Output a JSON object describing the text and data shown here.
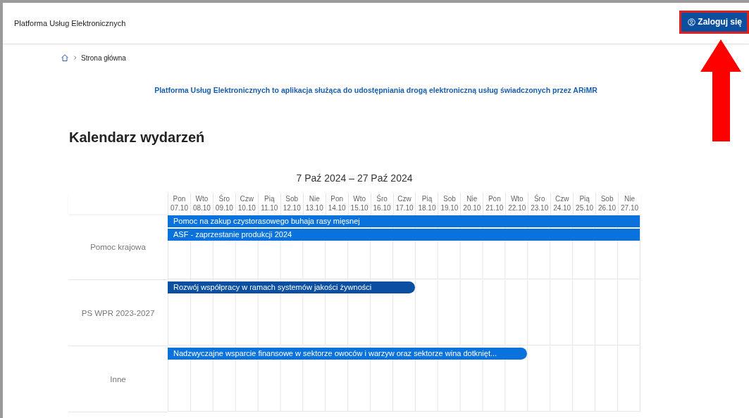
{
  "header": {
    "title": "Platforma Usług Elektronicznych",
    "login_button": "Zaloguj się"
  },
  "breadcrumb": [
    "Strona główna"
  ],
  "tagline": "Platforma Usług Elektronicznych to aplikacja służąca do udostępniania drogą elektroniczną usług świadczonych przez ARiMR",
  "heading": "Kalendarz wydarzeń",
  "calendar": {
    "range": "7 Paź 2024 – 27 Paź 2024",
    "days": [
      {
        "weekday": "Pon",
        "date": "07.10"
      },
      {
        "weekday": "Wto",
        "date": "08.10"
      },
      {
        "weekday": "Śro",
        "date": "09.10"
      },
      {
        "weekday": "Czw",
        "date": "10.10"
      },
      {
        "weekday": "Pią",
        "date": "11.10"
      },
      {
        "weekday": "Sob",
        "date": "12.10"
      },
      {
        "weekday": "Nie",
        "date": "13.10"
      },
      {
        "weekday": "Pon",
        "date": "14.10"
      },
      {
        "weekday": "Wto",
        "date": "15.10"
      },
      {
        "weekday": "Śro",
        "date": "16.10"
      },
      {
        "weekday": "Czw",
        "date": "17.10"
      },
      {
        "weekday": "Pią",
        "date": "18.10"
      },
      {
        "weekday": "Sob",
        "date": "19.10"
      },
      {
        "weekday": "Nie",
        "date": "20.10"
      },
      {
        "weekday": "Pon",
        "date": "21.10"
      },
      {
        "weekday": "Wto",
        "date": "22.10"
      },
      {
        "weekday": "Śro",
        "date": "23.10"
      },
      {
        "weekday": "Czw",
        "date": "24.10"
      },
      {
        "weekday": "Pią",
        "date": "25.10"
      },
      {
        "weekday": "Sob",
        "date": "26.10"
      },
      {
        "weekday": "Nie",
        "date": "27.10"
      }
    ],
    "groups": [
      {
        "name": "Pomoc krajowa",
        "events": [
          {
            "title": "Pomoc na zakup czystorasowego buhaja rasy mięsnej",
            "continues": true,
            "color": "#0a72dd"
          },
          {
            "title": "ASF - zaprzestanie produkcji 2024",
            "continues": true,
            "color": "#0a72dd"
          }
        ]
      },
      {
        "name": "PS WPR 2023-2027",
        "events": [
          {
            "title": "Rozwój współpracy w ramach systemów jakości żywności",
            "continues": false,
            "color": "#0b4fa3"
          }
        ]
      },
      {
        "name": "Inne",
        "events": [
          {
            "title": "Nadzwyczajne wsparcie finansowe w sektorze owoców i warzyw oraz sektorze wina dotknięt...",
            "continues": false,
            "color": "#0a72dd"
          }
        ]
      }
    ]
  }
}
